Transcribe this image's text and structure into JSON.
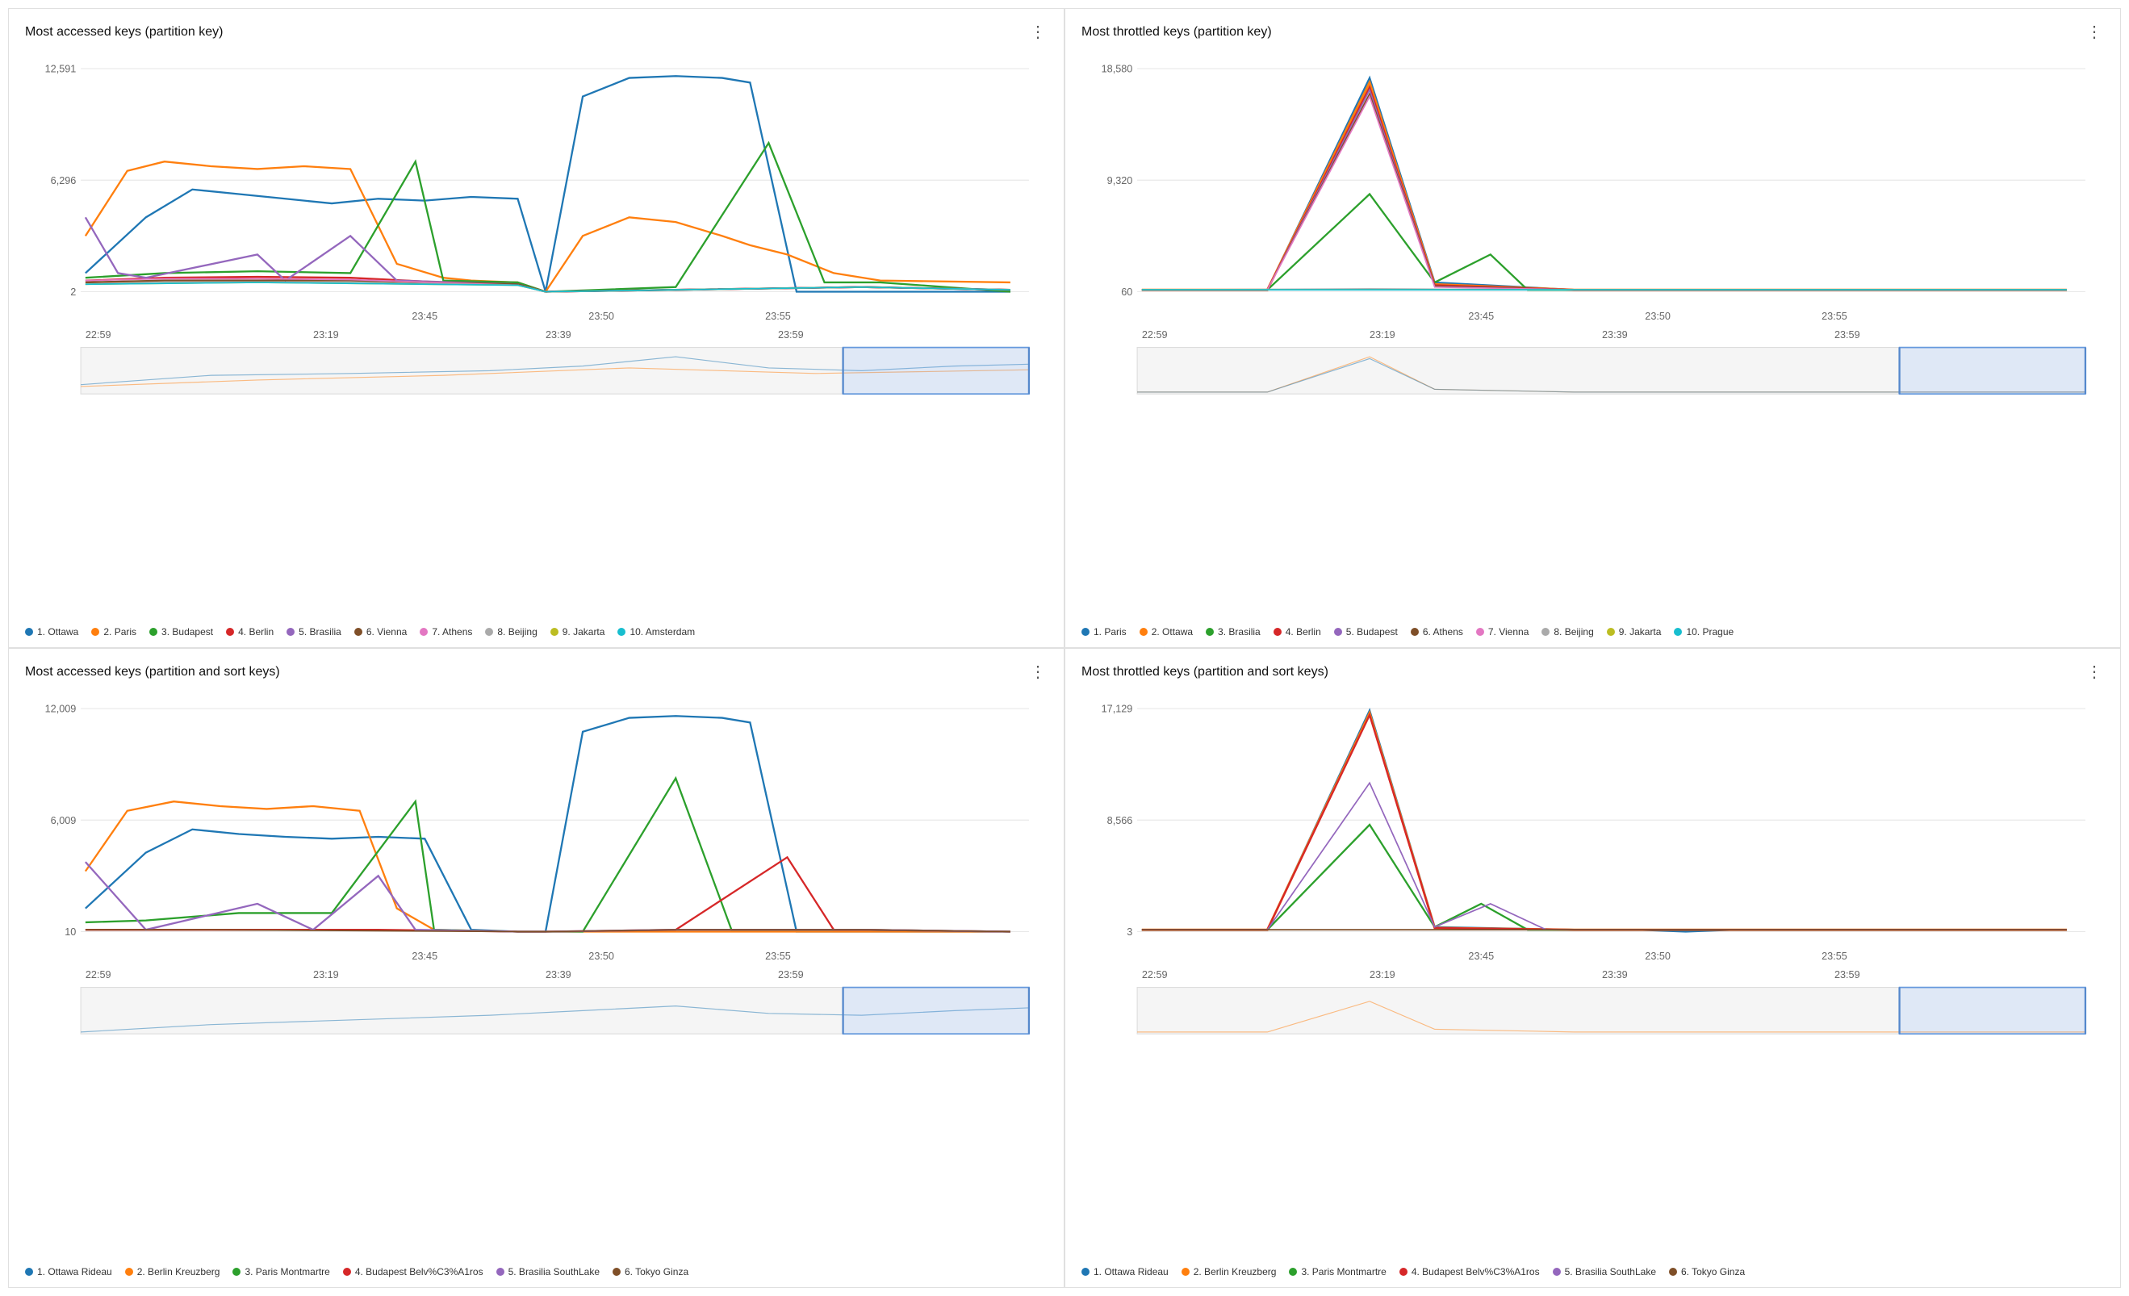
{
  "panels": [
    {
      "id": "top-left",
      "title": "Most accessed keys (partition key)",
      "yMax": "12,591",
      "yMid": "6,296",
      "yMin": "2",
      "xLabels": [
        "22:59",
        "23:19",
        "23:39",
        "23:59"
      ],
      "xTicksMid": [
        "23:45",
        "23:50",
        "23:55"
      ],
      "legend": [
        {
          "label": "1. Ottawa",
          "color": "#1f77b4"
        },
        {
          "label": "2. Paris",
          "color": "#ff7f0e"
        },
        {
          "label": "3. Budapest",
          "color": "#2ca02c"
        },
        {
          "label": "4. Berlin",
          "color": "#d62728"
        },
        {
          "label": "5. Brasilia",
          "color": "#9467bd"
        },
        {
          "label": "6. Vienna",
          "color": "#7f4f28"
        },
        {
          "label": "7. Athens",
          "color": "#e377c2"
        },
        {
          "label": "8. Beijing",
          "color": "#aaa"
        },
        {
          "label": "9. Jakarta",
          "color": "#bcbd22"
        },
        {
          "label": "10. Amsterdam",
          "color": "#17becf"
        }
      ]
    },
    {
      "id": "top-right",
      "title": "Most throttled keys (partition key)",
      "yMax": "18,580",
      "yMid": "9,320",
      "yMin": "60",
      "xLabels": [
        "22:59",
        "23:19",
        "23:39",
        "23:59"
      ],
      "xTicksMid": [
        "23:45",
        "23:50",
        "23:55"
      ],
      "legend": [
        {
          "label": "1. Paris",
          "color": "#1f77b4"
        },
        {
          "label": "2. Ottawa",
          "color": "#ff7f0e"
        },
        {
          "label": "3. Brasilia",
          "color": "#2ca02c"
        },
        {
          "label": "4. Berlin",
          "color": "#d62728"
        },
        {
          "label": "5. Budapest",
          "color": "#9467bd"
        },
        {
          "label": "6. Athens",
          "color": "#7f4f28"
        },
        {
          "label": "7. Vienna",
          "color": "#e377c2"
        },
        {
          "label": "8. Beijing",
          "color": "#aaa"
        },
        {
          "label": "9. Jakarta",
          "color": "#bcbd22"
        },
        {
          "label": "10. Prague",
          "color": "#17becf"
        }
      ]
    },
    {
      "id": "bottom-left",
      "title": "Most accessed keys (partition and sort keys)",
      "yMax": "12,009",
      "yMid": "6,009",
      "yMin": "10",
      "xLabels": [
        "22:59",
        "23:19",
        "23:39",
        "23:59"
      ],
      "xTicksMid": [
        "23:45",
        "23:50",
        "23:55"
      ],
      "legend": [
        {
          "label": "1. Ottawa Rideau",
          "color": "#1f77b4"
        },
        {
          "label": "2. Berlin Kreuzberg",
          "color": "#ff7f0e"
        },
        {
          "label": "3. Paris Montmartre",
          "color": "#2ca02c"
        },
        {
          "label": "4. Budapest Belv%C3%A1ros",
          "color": "#d62728"
        },
        {
          "label": "5. Brasilia SouthLake",
          "color": "#9467bd"
        },
        {
          "label": "6. Tokyo Ginza",
          "color": "#7f4f28"
        }
      ]
    },
    {
      "id": "bottom-right",
      "title": "Most throttled keys (partition and sort keys)",
      "yMax": "17,129",
      "yMid": "8,566",
      "yMin": "3",
      "xLabels": [
        "22:59",
        "23:19",
        "23:39",
        "23:59"
      ],
      "xTicksMid": [
        "23:45",
        "23:50",
        "23:55"
      ],
      "legend": [
        {
          "label": "1. Ottawa Rideau",
          "color": "#1f77b4"
        },
        {
          "label": "2. Berlin Kreuzberg",
          "color": "#ff7f0e"
        },
        {
          "label": "3. Paris Montmartre",
          "color": "#2ca02c"
        },
        {
          "label": "4. Budapest Belv%C3%A1ros",
          "color": "#d62728"
        },
        {
          "label": "5. Brasilia SouthLake",
          "color": "#9467bd"
        },
        {
          "label": "6. Tokyo Ginza",
          "color": "#7f4f28"
        }
      ]
    }
  ],
  "kebab_label": "⋮"
}
